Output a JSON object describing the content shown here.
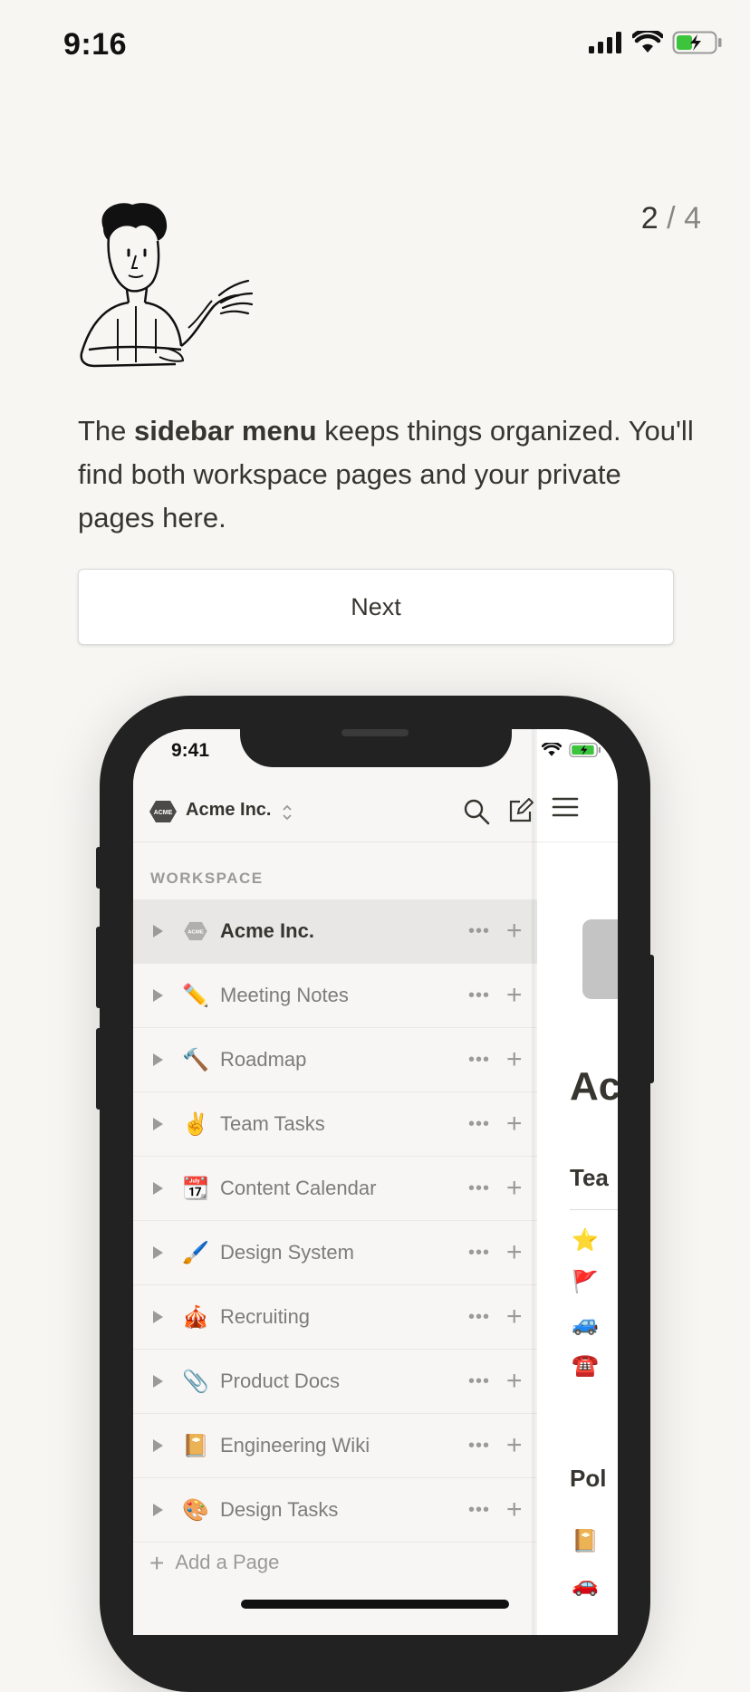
{
  "status_bar": {
    "time": "9:16"
  },
  "onboarding": {
    "step_current": "2",
    "step_separator": "/",
    "step_total": "4",
    "desc_before": "The ",
    "desc_bold": "sidebar menu",
    "desc_after": " keeps things organized. You'll find both workspace pages and your private pages here.",
    "next_label": "Next"
  },
  "mock_phone": {
    "time": "9:41",
    "workspace_name": "Acme Inc.",
    "logo_text": "ACME",
    "chevron": "⌃",
    "section_label": "WORKSPACE",
    "more_glyph": "•••",
    "plus_glyph": "+",
    "sidebar_items": [
      {
        "emoji": "",
        "label": "Acme Inc.",
        "active": true
      },
      {
        "emoji": "✏️",
        "label": "Meeting Notes"
      },
      {
        "emoji": "🔨",
        "label": "Roadmap"
      },
      {
        "emoji": "✌️",
        "label": "Team Tasks"
      },
      {
        "emoji": "📆",
        "label": "Content Calendar"
      },
      {
        "emoji": "🖌️",
        "label": "Design System"
      },
      {
        "emoji": "🎪",
        "label": "Recruiting"
      },
      {
        "emoji": "📎",
        "label": "Product Docs"
      },
      {
        "emoji": "📔",
        "label": "Engineering Wiki"
      },
      {
        "emoji": "🎨",
        "label": "Design Tasks"
      }
    ],
    "add_page_label": "Add a Page",
    "page_panel": {
      "title": "Ac",
      "h2_a": "Tea",
      "emojis_a": [
        "⭐",
        "🚩",
        "🚙",
        "☎️"
      ],
      "h2_b": "Pol",
      "emojis_b": [
        "📔",
        "🚗"
      ]
    }
  }
}
